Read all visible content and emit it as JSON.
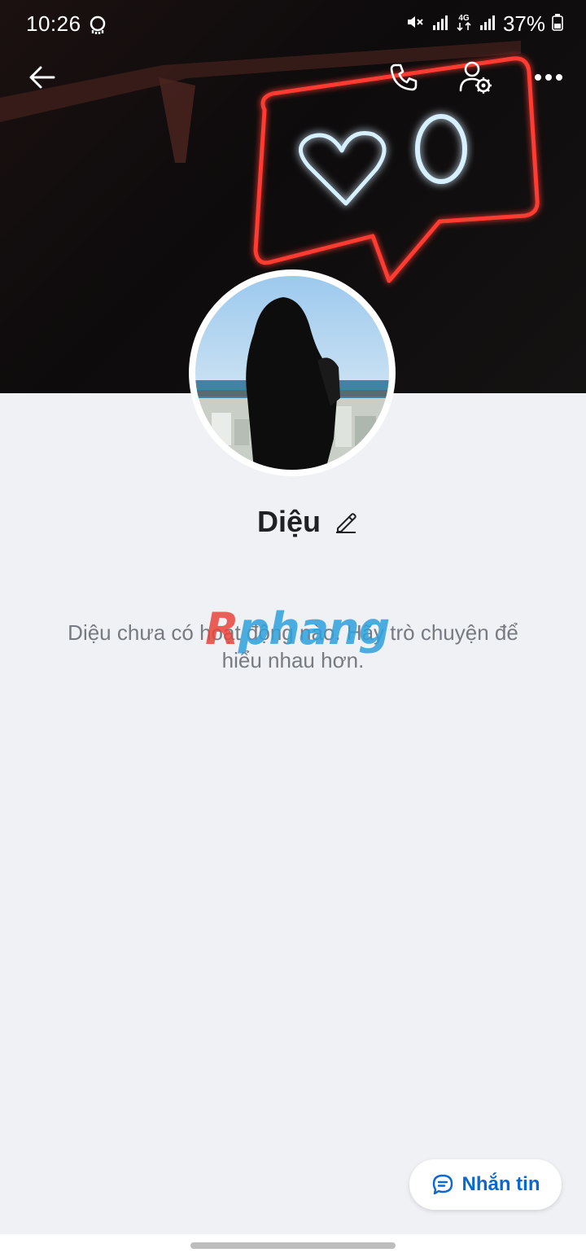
{
  "status_bar": {
    "time": "10:26",
    "battery_percent": "37%",
    "network_label": "4G"
  },
  "profile": {
    "name": "Diệu",
    "empty_activity_message": "Diệu chưa có hoạt động nào. Hãy trò chuyện để hiểu nhau hơn."
  },
  "actions": {
    "message_button_label": "Nhắn tin"
  },
  "watermark": {
    "first_letter": "R",
    "rest": "phang"
  },
  "icons": {
    "back": "arrow-left-icon",
    "call": "phone-icon",
    "profile_settings": "user-gear-icon",
    "more": "more-horizontal-icon",
    "edit": "pencil-icon",
    "message": "chat-bubble-icon"
  },
  "colors": {
    "accent": "#0a68d0",
    "background": "#eff1f5",
    "neon_red": "#ff3a30",
    "neon_blue": "#bfe6ff"
  }
}
